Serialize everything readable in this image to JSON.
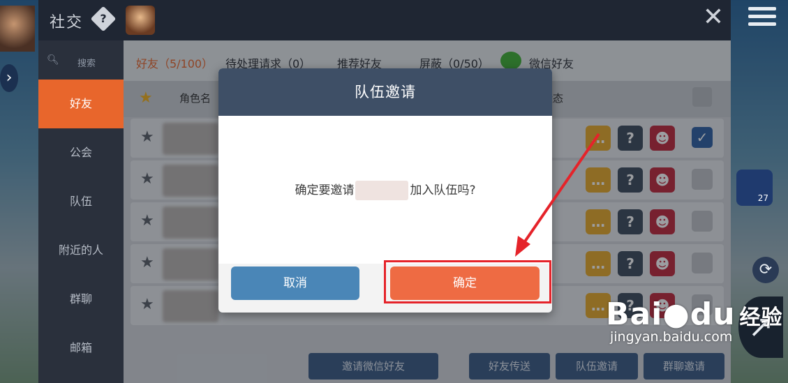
{
  "header": {
    "title": "社交",
    "close_label": "✕"
  },
  "sidebar": {
    "search_label": "搜索",
    "items": [
      {
        "label": "好友"
      },
      {
        "label": "公会"
      },
      {
        "label": "队伍"
      },
      {
        "label": "附近的人"
      },
      {
        "label": "群聊"
      },
      {
        "label": "邮箱"
      }
    ]
  },
  "tabs": [
    {
      "label": "好友（5/100）"
    },
    {
      "label": "待处理请求（0）"
    },
    {
      "label": "推荐好友"
    },
    {
      "label": "屏蔽（0/50）"
    },
    {
      "label": "微信好友"
    }
  ],
  "list_header": {
    "name": "角色名",
    "state": "状态"
  },
  "rows": [
    {
      "checked": true
    },
    {
      "checked": false
    },
    {
      "checked": false
    },
    {
      "checked": false
    },
    {
      "checked": false
    }
  ],
  "bottom_buttons": [
    {
      "label": "邀请微信好友"
    },
    {
      "label": "好友传送"
    },
    {
      "label": "队伍邀请"
    },
    {
      "label": "群聊邀请"
    }
  ],
  "dialog": {
    "title": "队伍邀请",
    "message_prefix": "确定要邀请",
    "message_suffix": "加入队伍吗?",
    "cancel_label": "取消",
    "confirm_label": "确定"
  },
  "right_panel": {
    "item_count": "27"
  },
  "watermark": {
    "brand": "Bai",
    "brand_du": "du",
    "brand_jy": "经验",
    "site": "jingyan.baidu.com"
  },
  "colors": {
    "accent": "#e8662c",
    "confirm": "#ee6b43",
    "cancel": "#4a86b7",
    "dialog_header": "#3e4f66",
    "highlight": "#e5232a"
  }
}
